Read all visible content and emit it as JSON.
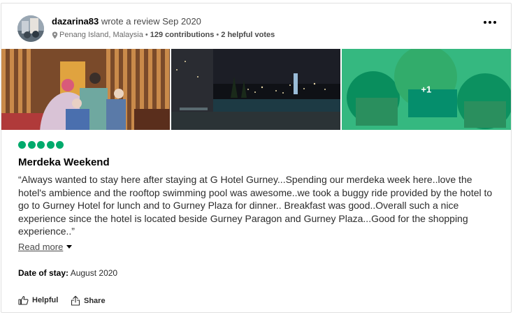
{
  "review": {
    "username": "dazarina83",
    "action_text": "wrote a review Sep 2020",
    "location": "Penang Island, Malaysia",
    "contributions": "129 contributions",
    "helpful_votes": "2 helpful votes",
    "separator": "•",
    "photos": [
      {
        "name": "family-photo"
      },
      {
        "name": "rooftop-pool-photo"
      },
      {
        "name": "selfie-photo",
        "overlay": "+1"
      }
    ],
    "rating": 5,
    "title": "Merdeka Weekend",
    "body": "“Always wanted to stay here after staying at G Hotel Gurney...Spending our merdeka week here..love the hotel's ambience and the rooftop swimming pool was awesome..we took a buggy ride provided by the hotel to go to Gurney Hotel for lunch and to Gurney Plaza for dinner.. Breakfast was good..Overall such a nice experience since the hotel is located beside Gurney Paragon and Gurney Plaza...Good for the shopping experience..”",
    "read_more": "Read more",
    "date_of_stay_label": "Date of stay:",
    "date_of_stay_value": "August 2020",
    "helpful_label": "Helpful",
    "share_label": "Share"
  },
  "colors": {
    "bubble": "#00aa6c",
    "photo_overlay": "#00aa6c"
  },
  "icons": [
    "pin-icon",
    "more-options-icon",
    "thumbs-up-icon",
    "share-icon",
    "chevron-down-icon"
  ]
}
